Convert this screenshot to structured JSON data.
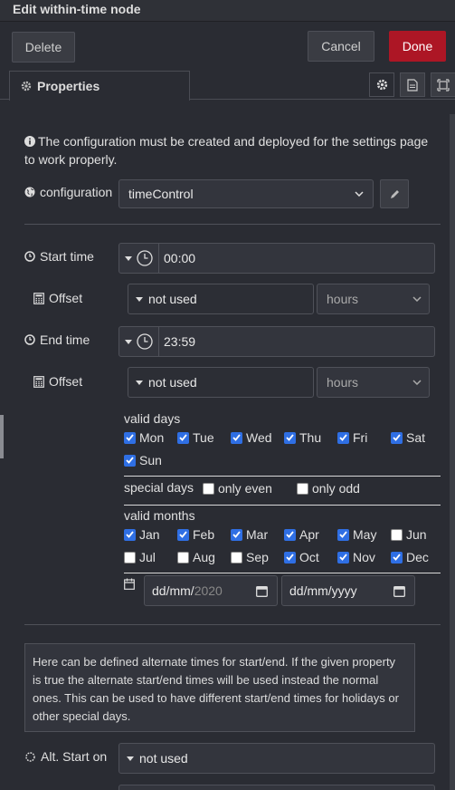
{
  "title": "Edit within-time node",
  "buttons": {
    "delete": "Delete",
    "cancel": "Cancel",
    "done": "Done"
  },
  "tab": {
    "label": "Properties"
  },
  "info_text": "The configuration must be created and deployed for the settings page to work properly.",
  "configuration": {
    "label": "configuration",
    "value": "timeControl"
  },
  "start_time": {
    "label": "Start time",
    "value": "00:00"
  },
  "start_offset": {
    "label": "Offset",
    "type": "not used",
    "unit": "hours"
  },
  "end_time": {
    "label": "End time",
    "value": "23:59"
  },
  "end_offset": {
    "label": "Offset",
    "type": "not used",
    "unit": "hours"
  },
  "valid_days": {
    "label": "valid days",
    "days": [
      {
        "name": "Mon",
        "checked": true
      },
      {
        "name": "Tue",
        "checked": true
      },
      {
        "name": "Wed",
        "checked": true
      },
      {
        "name": "Thu",
        "checked": true
      },
      {
        "name": "Fri",
        "checked": true
      },
      {
        "name": "Sat",
        "checked": true
      },
      {
        "name": "Sun",
        "checked": true
      }
    ]
  },
  "special_days": {
    "label": "special days",
    "even": "only even",
    "odd": "only odd"
  },
  "valid_months": {
    "label": "valid months",
    "months": [
      {
        "name": "Jan",
        "checked": true
      },
      {
        "name": "Feb",
        "checked": true
      },
      {
        "name": "Mar",
        "checked": true
      },
      {
        "name": "Apr",
        "checked": true
      },
      {
        "name": "May",
        "checked": true
      },
      {
        "name": "Jun",
        "checked": false
      },
      {
        "name": "Jul",
        "checked": false
      },
      {
        "name": "Aug",
        "checked": false
      },
      {
        "name": "Sep",
        "checked": false
      },
      {
        "name": "Oct",
        "checked": true
      },
      {
        "name": "Nov",
        "checked": true
      },
      {
        "name": "Dec",
        "checked": true
      }
    ]
  },
  "date_range": {
    "start": "dd/mm/",
    "start_year": "2020",
    "end": "dd/mm/yyyy"
  },
  "alt_info": "Here can be defined alternate times for start/end. If the given property is true the alternate start/end times will be used instead the normal ones. This can be used to have different start/end times for holidays or other special days.",
  "alt_start": {
    "label": "Alt. Start on",
    "value": "not used"
  },
  "colors": {
    "done": "#ad1625",
    "checkbox": "#2f6fe4",
    "background": "#2a2c33"
  }
}
